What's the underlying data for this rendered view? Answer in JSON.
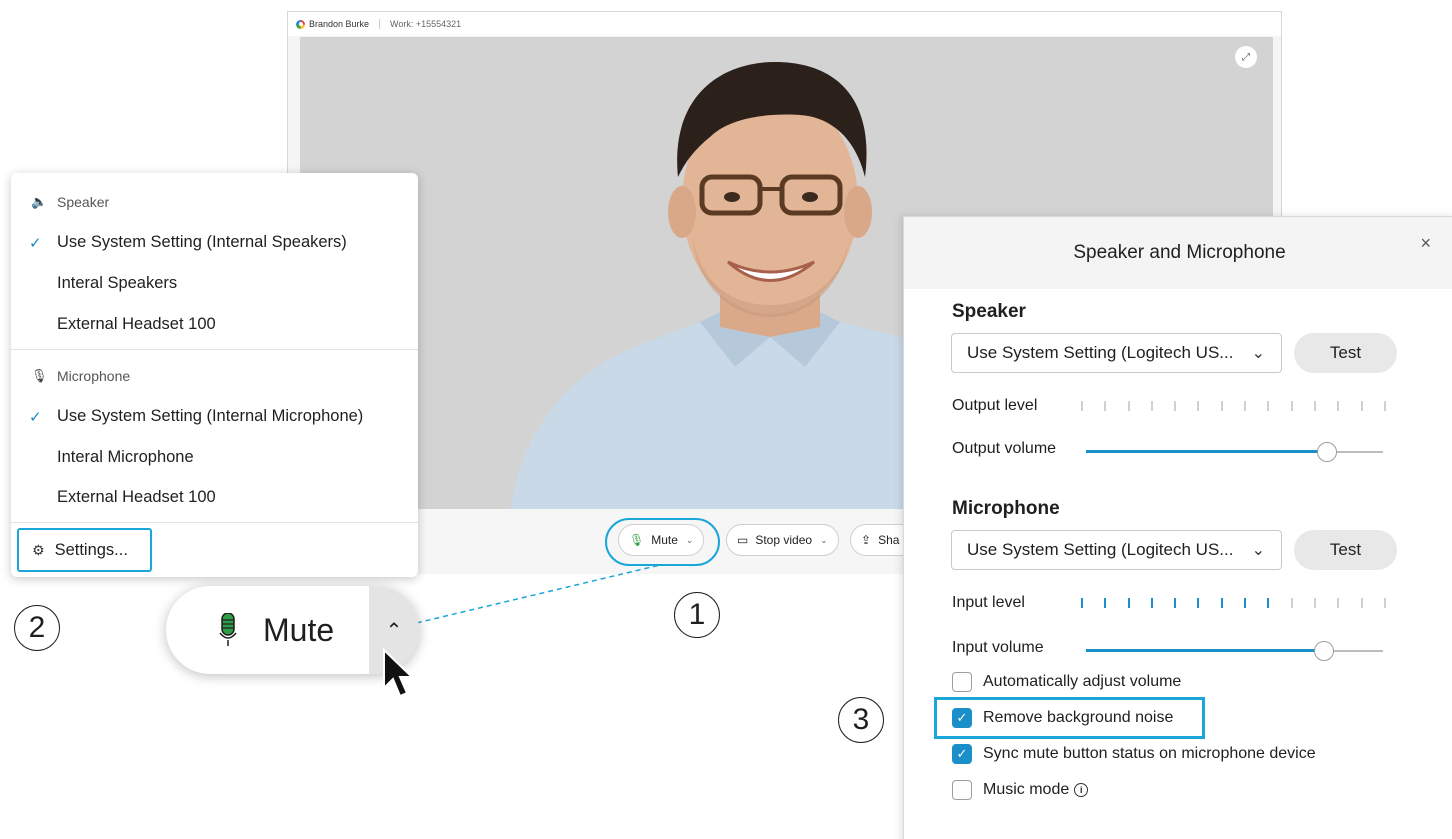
{
  "call": {
    "contact_name": "Brandon Burke",
    "contact_work": "Work: +15554321",
    "controls": {
      "mute_label": "Mute",
      "stop_video_label": "Stop video",
      "share_label": "Sha"
    }
  },
  "device_menu": {
    "speaker_heading": "Speaker",
    "speaker_items": [
      {
        "label": "Use System Setting (Internal Speakers)",
        "checked": true
      },
      {
        "label": "Interal Speakers",
        "checked": false
      },
      {
        "label": "External Headset 100",
        "checked": false
      }
    ],
    "microphone_heading": "Microphone",
    "microphone_items": [
      {
        "label": "Use System Setting (Internal Microphone)",
        "checked": true
      },
      {
        "label": "Interal Microphone",
        "checked": false
      },
      {
        "label": "External Headset 100",
        "checked": false
      }
    ],
    "settings_label": "Settings..."
  },
  "big_mute": {
    "label": "Mute"
  },
  "steps": {
    "one": "1",
    "two": "2",
    "three": "3"
  },
  "dialog": {
    "title": "Speaker and Microphone",
    "close_glyph": "×",
    "speaker": {
      "heading": "Speaker",
      "select_value": "Use System Setting (Logitech US...",
      "test_label": "Test",
      "output_level_label": "Output level",
      "output_level_active_ticks": 0,
      "output_volume_label": "Output volume",
      "output_volume_percent": 81
    },
    "microphone": {
      "heading": "Microphone",
      "select_value": "Use System Setting (Logitech US...",
      "test_label": "Test",
      "input_level_label": "Input level",
      "input_level_active_ticks": 9,
      "input_volume_label": "Input volume",
      "input_volume_percent": 80
    },
    "options": [
      {
        "label": "Automatically adjust volume",
        "checked": false
      },
      {
        "label": "Remove background noise",
        "checked": true
      },
      {
        "label": "Sync mute button status on microphone device",
        "checked": true
      },
      {
        "label": "Music mode",
        "checked": false
      }
    ]
  },
  "colors": {
    "accent": "#1b8fc9",
    "highlight": "#1aa6d8",
    "mic_green": "#2e9e47"
  }
}
